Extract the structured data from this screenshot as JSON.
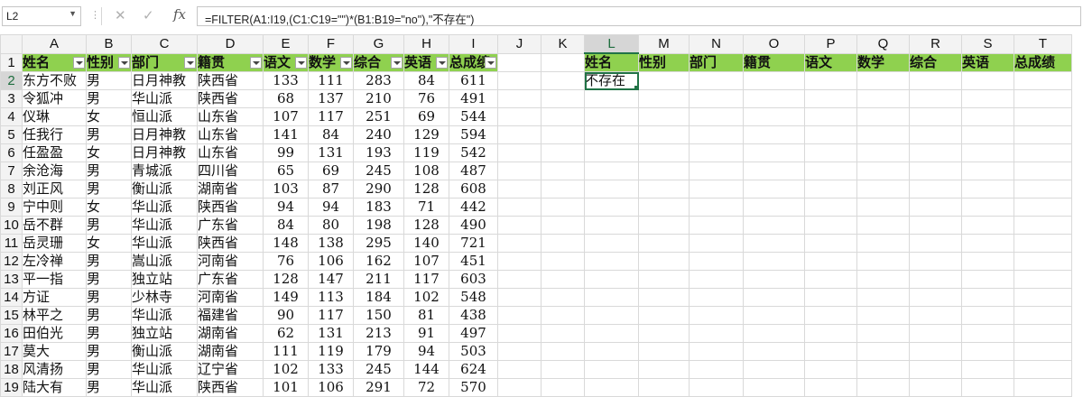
{
  "formula_bar": {
    "name_box": "L2",
    "fx": "fx",
    "formula": "=FILTER(A1:I19,(C1:C19=\"\")*(B1:B19=\"no\"),\"不存在\")"
  },
  "columns": [
    "A",
    "B",
    "C",
    "D",
    "E",
    "F",
    "G",
    "H",
    "I",
    "J",
    "K",
    "L",
    "M",
    "N",
    "O",
    "P",
    "Q",
    "R",
    "S",
    "T"
  ],
  "rows": [
    "1",
    "2",
    "3",
    "4",
    "5",
    "6",
    "7",
    "8",
    "9",
    "10",
    "11",
    "12",
    "13",
    "14",
    "15",
    "16",
    "17",
    "18",
    "19"
  ],
  "headers": [
    "姓名",
    "性别",
    "部门",
    "籍贯",
    "语文",
    "数学",
    "综合",
    "英语",
    "总成绩"
  ],
  "data": [
    [
      "东方不败",
      "男",
      "日月神教",
      "陕西省",
      "133",
      "111",
      "283",
      "84",
      "611"
    ],
    [
      "令狐冲",
      "男",
      "华山派",
      "陕西省",
      "68",
      "137",
      "210",
      "76",
      "491"
    ],
    [
      "仪琳",
      "女",
      "恒山派",
      "山东省",
      "107",
      "117",
      "251",
      "69",
      "544"
    ],
    [
      "任我行",
      "男",
      "日月神教",
      "山东省",
      "141",
      "84",
      "240",
      "129",
      "594"
    ],
    [
      "任盈盈",
      "女",
      "日月神教",
      "山东省",
      "99",
      "131",
      "193",
      "119",
      "542"
    ],
    [
      "余沧海",
      "男",
      "青城派",
      "四川省",
      "65",
      "69",
      "245",
      "108",
      "487"
    ],
    [
      "刘正风",
      "男",
      "衡山派",
      "湖南省",
      "103",
      "87",
      "290",
      "128",
      "608"
    ],
    [
      "宁中则",
      "女",
      "华山派",
      "陕西省",
      "94",
      "94",
      "183",
      "71",
      "442"
    ],
    [
      "岳不群",
      "男",
      "华山派",
      "广东省",
      "84",
      "80",
      "198",
      "128",
      "490"
    ],
    [
      "岳灵珊",
      "女",
      "华山派",
      "陕西省",
      "148",
      "138",
      "295",
      "140",
      "721"
    ],
    [
      "左冷禅",
      "男",
      "嵩山派",
      "河南省",
      "76",
      "106",
      "162",
      "107",
      "451"
    ],
    [
      "平一指",
      "男",
      "独立站",
      "广东省",
      "128",
      "147",
      "211",
      "117",
      "603"
    ],
    [
      "方证",
      "男",
      "少林寺",
      "河南省",
      "149",
      "113",
      "184",
      "102",
      "548"
    ],
    [
      "林平之",
      "男",
      "华山派",
      "福建省",
      "90",
      "117",
      "150",
      "81",
      "438"
    ],
    [
      "田伯光",
      "男",
      "独立站",
      "湖南省",
      "62",
      "131",
      "213",
      "91",
      "497"
    ],
    [
      "莫大",
      "男",
      "衡山派",
      "湖南省",
      "111",
      "119",
      "179",
      "94",
      "503"
    ],
    [
      "风清扬",
      "男",
      "华山派",
      "辽宁省",
      "102",
      "133",
      "245",
      "144",
      "624"
    ],
    [
      "陆大有",
      "男",
      "华山派",
      "陕西省",
      "101",
      "106",
      "291",
      "72",
      "570"
    ]
  ],
  "result_headers": [
    "姓名",
    "性别",
    "部门",
    "籍贯",
    "语文",
    "数学",
    "综合",
    "英语",
    "总成绩"
  ],
  "result_value": "不存在",
  "icons": {
    "cancel": "close-icon",
    "enter": "check-icon",
    "dropdown": "chevron-down-icon"
  },
  "colors": {
    "header_fill": "#8fd14f",
    "selection": "#217346"
  }
}
